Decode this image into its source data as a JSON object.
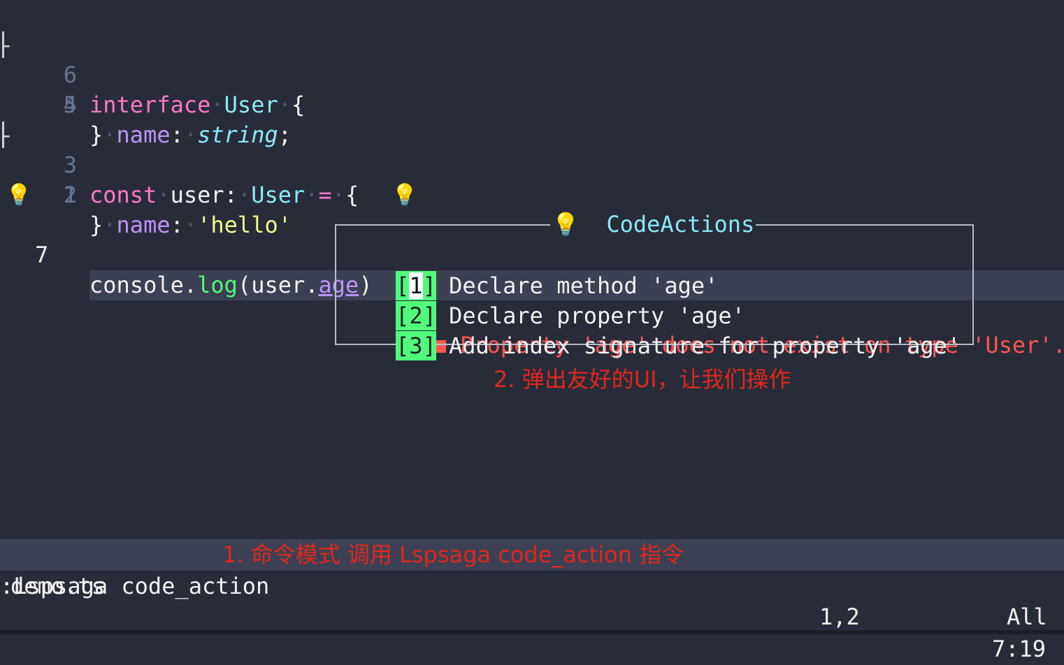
{
  "editor": {
    "lines": [
      {
        "num": "6",
        "sign": "-",
        "tokens": [
          [
            "kw",
            "interface"
          ],
          [
            "dot",
            "·"
          ],
          [
            "ty",
            "User"
          ],
          [
            "dot",
            "·"
          ],
          [
            "plain",
            "{"
          ]
        ]
      },
      {
        "num": "5",
        "sign": "bar",
        "tokens": [
          [
            "dot",
            "··"
          ],
          [
            "prop",
            "name"
          ],
          [
            "plain",
            ":"
          ],
          [
            "dot",
            "·"
          ],
          [
            "ital",
            "string"
          ],
          [
            "plain",
            ";"
          ]
        ]
      },
      {
        "num": "4",
        "sign": "",
        "tokens": [
          [
            "plain",
            "}"
          ]
        ]
      },
      {
        "num": "3",
        "sign": "-",
        "tokens": [
          [
            "kw",
            "const"
          ],
          [
            "dot",
            "·"
          ],
          [
            "plain",
            "user:"
          ],
          [
            "dot",
            "·"
          ],
          [
            "ty",
            "User"
          ],
          [
            "dot",
            "·"
          ],
          [
            "op",
            "="
          ],
          [
            "dot",
            "·"
          ],
          [
            "plain",
            "{"
          ]
        ]
      },
      {
        "num": "2",
        "sign": "bar",
        "tokens": [
          [
            "dot",
            "··"
          ],
          [
            "prop",
            "name"
          ],
          [
            "plain",
            ":"
          ],
          [
            "dot",
            "·"
          ],
          [
            "str",
            "'hello'"
          ]
        ]
      },
      {
        "num": "1",
        "sign": "",
        "tokens": [
          [
            "plain",
            "}"
          ]
        ]
      }
    ],
    "current_line": {
      "num": "7",
      "code_prefix": "console.",
      "code_fn": "log",
      "code_mid": "(user.",
      "code_under": "age",
      "code_suffix": ")",
      "diagnostic": "Property 'age' does not exist on type 'User'."
    }
  },
  "code_actions": {
    "title": "CodeActions",
    "items": [
      {
        "index_open": "[",
        "index": "1",
        "index_close": "]",
        "label": "Declare method 'age'"
      },
      {
        "index": "[2]",
        "label": "Declare property 'age'"
      },
      {
        "index": "[3]",
        "label": "Add index signature for property 'age'"
      }
    ]
  },
  "annotations": {
    "popup_note": "2. 弹出友好的UI，让我们操作",
    "command_note": "1. 命令模式 调用 Lspsaga code_action 指令"
  },
  "statusbar": {
    "filename": "demo.ts",
    "position": "7:19"
  },
  "cmdline": ":Lspsaga code_action",
  "ruler": {
    "cursor": "1,2",
    "scroll": "All"
  },
  "icons": {
    "bulb": "💡"
  },
  "colors": {
    "background": "#282c38",
    "keyword": "#ff79c6",
    "type": "#8be9fd",
    "property": "#bd93f9",
    "string": "#f1fa8c",
    "function": "#50fa7b",
    "error": "#ff5555",
    "action_index_bg": "#50fa7b",
    "annotation": "#e0261e"
  }
}
